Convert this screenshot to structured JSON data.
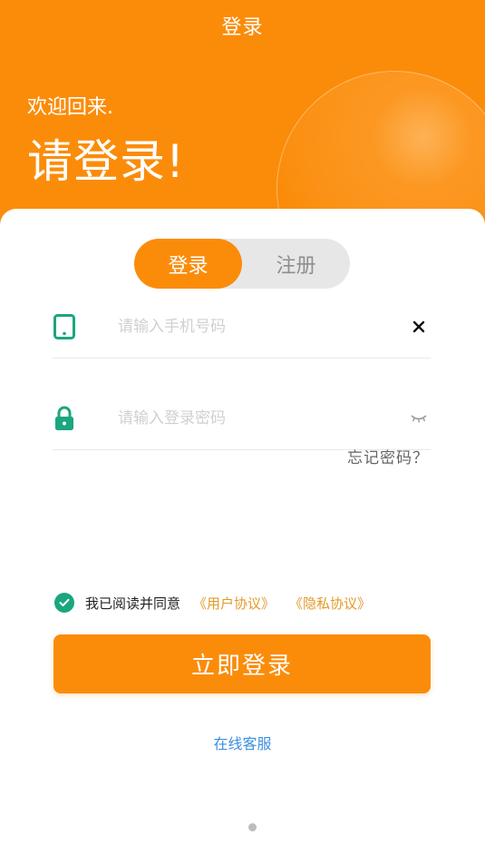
{
  "header": {
    "title": "登录"
  },
  "hero": {
    "welcome": "欢迎回来.",
    "headline": "请登录!"
  },
  "tabs": [
    {
      "label": "登录",
      "active": true
    },
    {
      "label": "注册",
      "active": false
    }
  ],
  "phone": {
    "placeholder": "请输入手机号码",
    "value": "",
    "icon": "phone-icon",
    "clear_icon": "close-icon"
  },
  "password": {
    "placeholder": "请输入登录密码",
    "value": "",
    "icon": "lock-icon",
    "toggle_icon": "eye-closed-icon"
  },
  "forgot_label": "忘记密码？",
  "agreement": {
    "checked": true,
    "text": "我已阅读并同意",
    "user_link": "《用户协议》",
    "privacy_link": "《隐私协议》"
  },
  "login_button": "立即登录",
  "customer_service": "在线客服",
  "colors": {
    "primary": "#fb8c0a",
    "accent_green": "#1aa67f",
    "link_orange": "#e29a2a",
    "link_blue": "#3d8fe0"
  }
}
